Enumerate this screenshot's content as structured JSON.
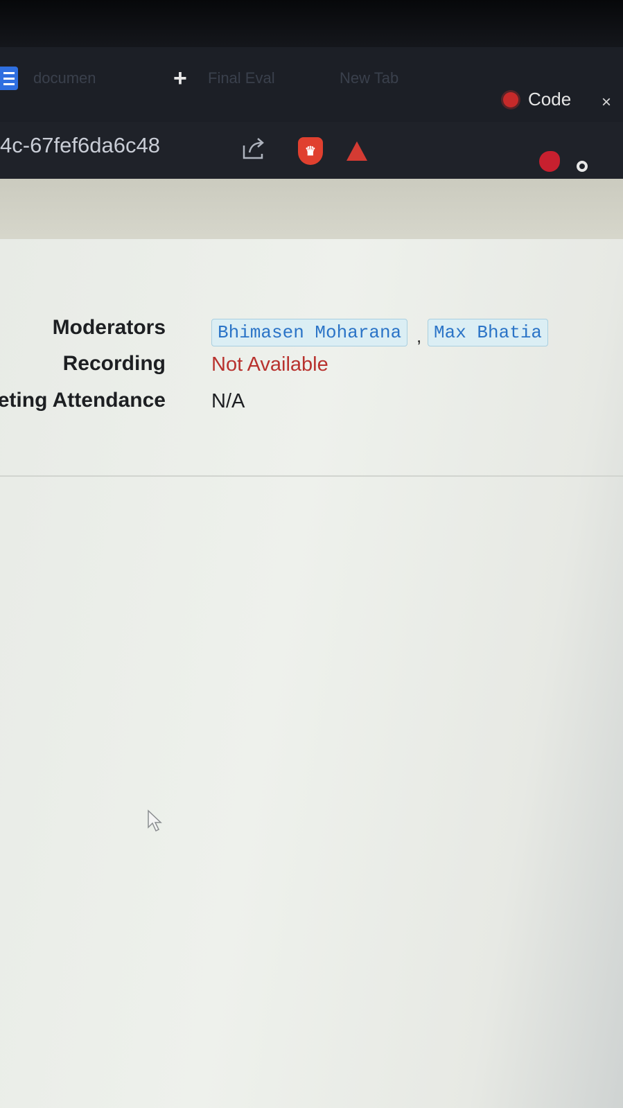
{
  "browser": {
    "tabs": [
      {
        "label": "documen"
      },
      {
        "label": "Final Eval"
      },
      {
        "label": "New Tab"
      }
    ],
    "active_tab": {
      "label": "Code",
      "close": "×"
    },
    "url": "4c-67fef6da6c48"
  },
  "details": {
    "moderators_label": "Moderators",
    "moderators": [
      "Bhimasen Moharana",
      "Max Bhatia"
    ],
    "separator": ",",
    "recording_label": "Recording",
    "recording_value": "Not Available",
    "recording_color": "#b8322e",
    "attendance_label": "eting Attendance",
    "attendance_value": "N/A"
  }
}
